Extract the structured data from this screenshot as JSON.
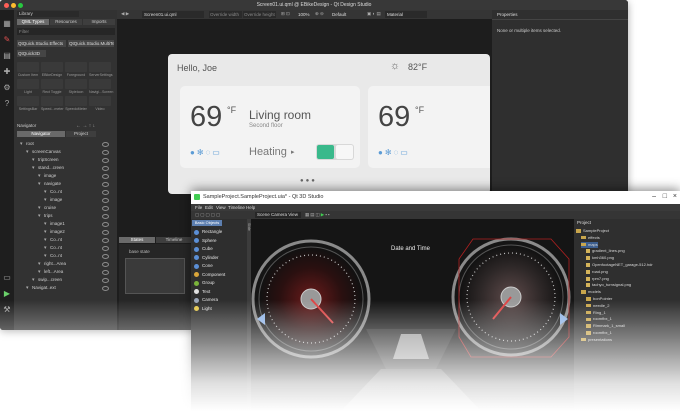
{
  "qds": {
    "title": "Screen01.ui.qml @ EBikeDesign - Qt Design Studio",
    "library": {
      "dropdown": "Library",
      "tabs": [
        "QML Types",
        "Resources",
        "Imports"
      ],
      "filter_placeholder": "Filter",
      "buttons": [
        "QtQuick.Studio.Effects",
        "QtQuick.Studio.MultiText",
        "QtQuick3D"
      ],
      "cells": [
        "Custom Item",
        "EBikeDesign",
        "Foreground",
        "ServerSettings",
        "Light",
        "Rect Toggle",
        "StyleIcon",
        "Navigi...Screen",
        "SettingsBar",
        "Speed...meter",
        "SpeedoMeter",
        "Video"
      ]
    },
    "navigator": {
      "dropdown": "Navigator",
      "tabs": [
        "Navigator",
        "Project"
      ],
      "items": [
        {
          "label": "root",
          "level": 0
        },
        {
          "label": "screenCanvas",
          "level": 1
        },
        {
          "label": "tripScreen",
          "level": 2
        },
        {
          "label": "stand...creen",
          "level": 2
        },
        {
          "label": "image",
          "level": 3
        },
        {
          "label": "navigate",
          "level": 3
        },
        {
          "label": "Co..nt",
          "level": 4
        },
        {
          "label": "image",
          "level": 4
        },
        {
          "label": "cruise",
          "level": 3
        },
        {
          "label": "trips",
          "level": 3
        },
        {
          "label": "image1",
          "level": 4
        },
        {
          "label": "image2",
          "level": 4
        },
        {
          "label": "Co..nt",
          "level": 4
        },
        {
          "label": "Co..nt",
          "level": 4
        },
        {
          "label": "Co..nt",
          "level": 4
        },
        {
          "label": "right...Area",
          "level": 3
        },
        {
          "label": "left...Area",
          "level": 3
        },
        {
          "label": "swip...creen",
          "level": 2
        },
        {
          "label": "Navigat..ext",
          "level": 1
        }
      ]
    },
    "toolbar": {
      "file_tab": "Screen01.ui.qml",
      "override_width": "Override width",
      "override_height": "Override height",
      "zoom": "100%",
      "state": "Default",
      "style": "Material"
    },
    "properties": {
      "title": "Properties",
      "message": "None or multiple items selected."
    },
    "bottom_tabs": [
      "States",
      "Timeline"
    ],
    "base_state": "base state",
    "app": {
      "greeting": "Hello, Joe",
      "weather_temp": "82°F",
      "temp_big": "69",
      "temp_unit": "°F",
      "room": "Living room",
      "floor": "Second floor",
      "heating_label": "Heating",
      "temp_big2": "69",
      "temp_unit2": "°F"
    }
  },
  "q3d": {
    "title": "SampleProject.SampleProject.uia* - Qt 3D Studio",
    "menu": [
      "File",
      "Edit",
      "View",
      "Timeline",
      "Help"
    ],
    "camera_select": "Scene Camera View",
    "basic_objects_tabs": [
      "Basic Objects",
      "Slide"
    ],
    "basic_objects": [
      "Rectangle",
      "Sphere",
      "Cube",
      "Cylinder",
      "Cone",
      "Component",
      "Group",
      "Text",
      "Camera",
      "Light"
    ],
    "scene_label": "Date and Time",
    "project": {
      "title": "Project",
      "items": [
        {
          "label": "SampleProject",
          "type": "folder",
          "level": 0
        },
        {
          "label": "effects",
          "type": "folder",
          "level": 1
        },
        {
          "label": "maps",
          "type": "folder",
          "level": 1
        },
        {
          "label": "gradient_lines.png",
          "type": "file",
          "level": 2
        },
        {
          "label": "kmh360.png",
          "type": "file",
          "level": 2
        },
        {
          "label": "OpenfootageNET_garage-512.hdr",
          "type": "file",
          "level": 2
        },
        {
          "label": "road.png",
          "type": "file",
          "level": 2
        },
        {
          "label": "rpm7.png",
          "type": "file",
          "level": 2
        },
        {
          "label": "tachyo_turnsignal.png",
          "type": "file",
          "level": 2
        },
        {
          "label": "models",
          "type": "folder",
          "level": 1
        },
        {
          "label": "bonPointer",
          "type": "folder",
          "level": 2
        },
        {
          "label": "needle_2",
          "type": "folder",
          "level": 2
        },
        {
          "label": "Ring_1",
          "type": "folder",
          "level": 2
        },
        {
          "label": "roomfbx_1",
          "type": "folder",
          "level": 2
        },
        {
          "label": "Rimmark_1_small",
          "type": "folder",
          "level": 2
        },
        {
          "label": "roomfbx_1",
          "type": "folder",
          "level": 2
        },
        {
          "label": "presentations",
          "type": "folder",
          "level": 1
        }
      ]
    }
  }
}
